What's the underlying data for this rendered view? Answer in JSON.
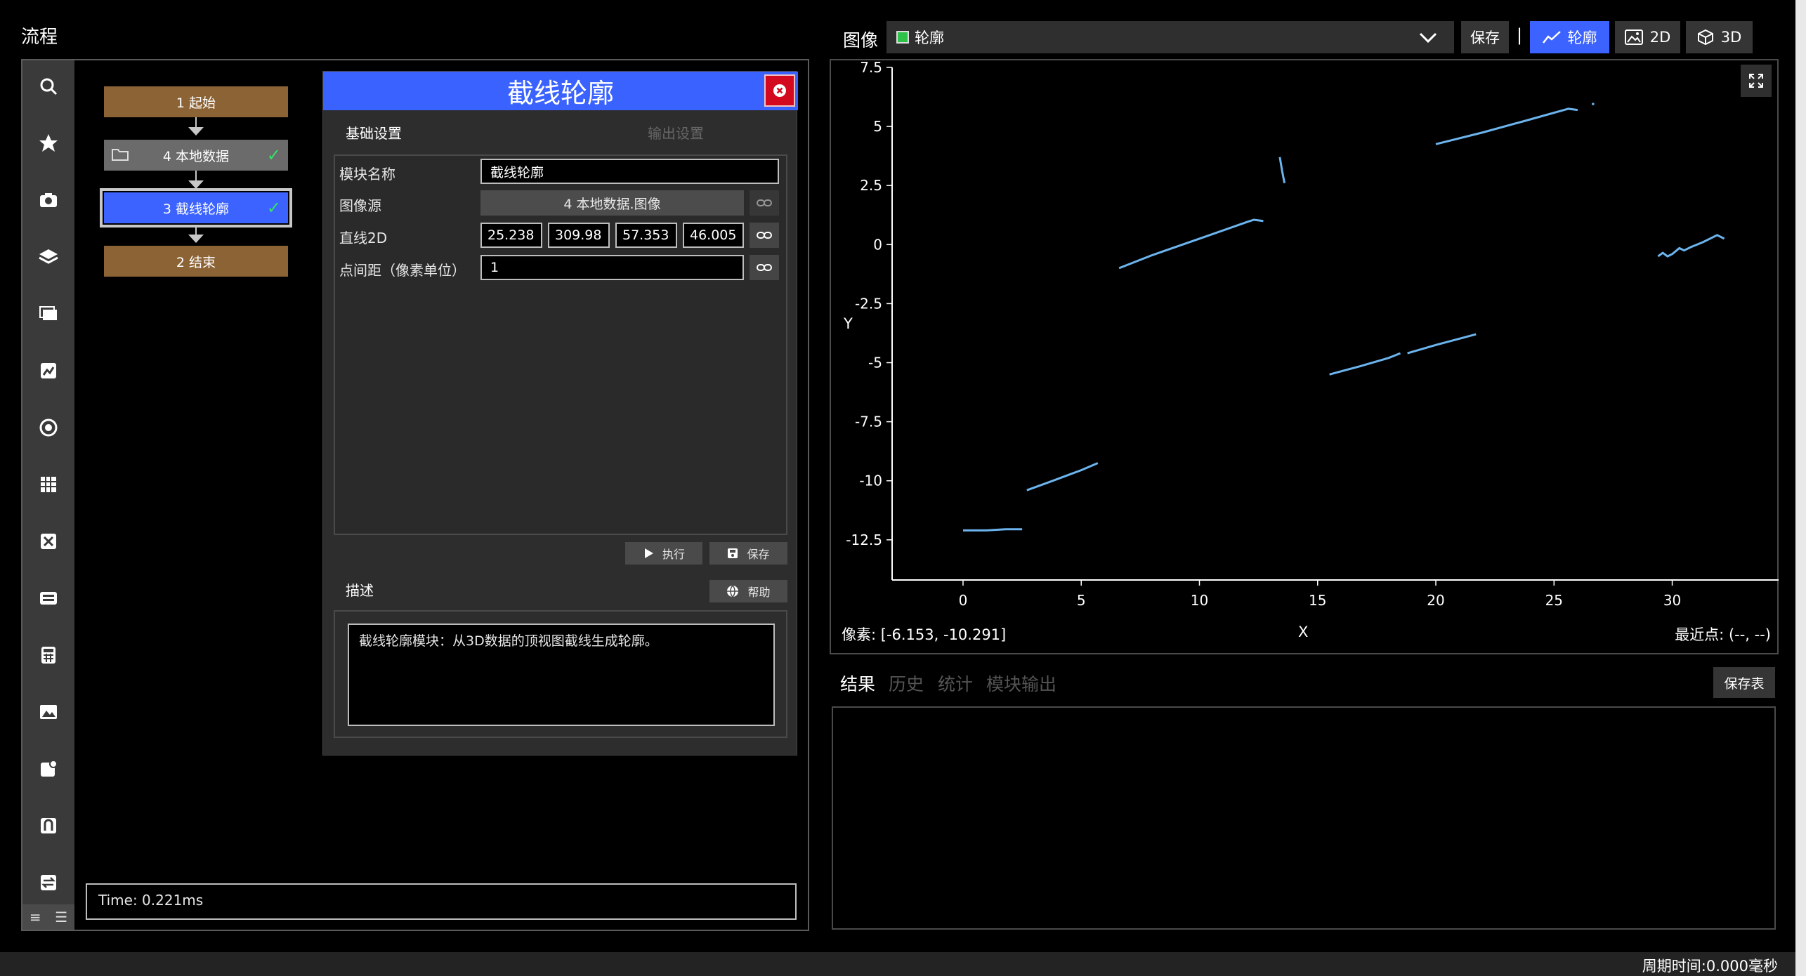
{
  "flow": {
    "title": "流程",
    "nodes": [
      {
        "label": "1 起始"
      },
      {
        "label": "4 本地数据"
      },
      {
        "label": "3 截线轮廓"
      },
      {
        "label": "2 结束"
      }
    ],
    "time": "Time: 0.221ms",
    "toolbar_icons": [
      "search-icon",
      "star-icon",
      "camera-icon",
      "layers-icon",
      "frames-icon",
      "image-edit-icon",
      "target-icon",
      "grid-icon",
      "tools-icon",
      "keyboard-icon",
      "calculator-icon",
      "picture-icon",
      "chart-icon",
      "magnet-icon",
      "transfer-icon"
    ]
  },
  "dialog": {
    "title": "截线轮廓",
    "tab_basic": "基础设置",
    "tab_output": "输出设置",
    "fields": {
      "module_name_label": "模块名称",
      "module_name_value": "截线轮廓",
      "image_source_label": "图像源",
      "image_source_value": "4 本地数据.图像",
      "line2d_label": "直线2D",
      "line2d_values": [
        "25.238",
        "309.98",
        "57.353",
        "46.005"
      ],
      "spacing_label": "点间距（像素单位）",
      "spacing_value": "1"
    },
    "run_label": "执行",
    "save_label": "保存",
    "desc_title": "描述",
    "help_label": "帮助",
    "description": "截线轮廓模块：从3D数据的顶视图截线生成轮廓。"
  },
  "image_panel": {
    "label": "图像",
    "selected_source": "轮廓",
    "save_label": "保存",
    "separator": "|",
    "views": [
      {
        "label": "轮廓",
        "active": true
      },
      {
        "label": "2D",
        "active": false
      },
      {
        "label": "3D",
        "active": false
      }
    ],
    "pixel_readout": "像素: [-6.153, -10.291]",
    "nearest_readout": "最近点: (--, --)"
  },
  "chart_data": {
    "type": "scatter",
    "xlabel": "X",
    "ylabel": "Y",
    "xlim": [
      -3,
      34.5
    ],
    "ylim": [
      -14.2,
      7.5
    ],
    "xticks": [
      0,
      5,
      10,
      15,
      20,
      25,
      30
    ],
    "yticks": [
      7.5,
      5,
      2.5,
      0,
      -2.5,
      -5,
      -7.5,
      -10,
      -12.5
    ],
    "color": "#6cb4ee",
    "series": [
      {
        "values": [
          [
            0.0,
            -12.1
          ],
          [
            1.0,
            -12.1
          ],
          [
            1.8,
            -12.05
          ],
          [
            2.5,
            -12.05
          ]
        ]
      },
      {
        "values": [
          [
            2.7,
            -10.4
          ],
          [
            3.8,
            -10.0
          ],
          [
            5.0,
            -9.55
          ],
          [
            5.7,
            -9.25
          ]
        ]
      },
      {
        "values": [
          [
            6.6,
            -1.0
          ],
          [
            8.0,
            -0.45
          ],
          [
            10.0,
            0.25
          ],
          [
            12.0,
            0.95
          ],
          [
            12.3,
            1.05
          ],
          [
            12.7,
            1.0
          ]
        ]
      },
      {
        "values": [
          [
            13.4,
            3.7
          ],
          [
            13.5,
            3.1
          ],
          [
            13.6,
            2.6
          ]
        ]
      },
      {
        "values": [
          [
            15.5,
            -5.5
          ],
          [
            16.8,
            -5.15
          ],
          [
            18.0,
            -4.8
          ],
          [
            18.5,
            -4.6
          ]
        ]
      },
      {
        "values": [
          [
            18.8,
            -4.6
          ],
          [
            20.0,
            -4.25
          ],
          [
            21.7,
            -3.8
          ]
        ]
      },
      {
        "values": [
          [
            20.0,
            4.25
          ],
          [
            22.0,
            4.75
          ],
          [
            24.0,
            5.3
          ],
          [
            25.6,
            5.75
          ],
          [
            26.0,
            5.7
          ]
        ]
      },
      {
        "values": [
          [
            26.6,
            5.95
          ],
          [
            26.7,
            5.95
          ]
        ]
      },
      {
        "values": [
          [
            29.4,
            -0.5
          ],
          [
            29.6,
            -0.35
          ],
          [
            29.8,
            -0.5
          ],
          [
            30.0,
            -0.4
          ],
          [
            30.3,
            -0.15
          ],
          [
            30.5,
            -0.25
          ],
          [
            30.8,
            -0.1
          ],
          [
            31.3,
            0.1
          ],
          [
            31.9,
            0.4
          ],
          [
            32.2,
            0.25
          ]
        ]
      }
    ]
  },
  "results": {
    "tabs": [
      {
        "label": "结果",
        "active": true
      },
      {
        "label": "历史",
        "active": false
      },
      {
        "label": "统计",
        "active": false
      },
      {
        "label": "模块输出",
        "active": false
      }
    ],
    "save_table_label": "保存表"
  },
  "status": {
    "cycle_time": "周期时间:0.000毫秒"
  }
}
